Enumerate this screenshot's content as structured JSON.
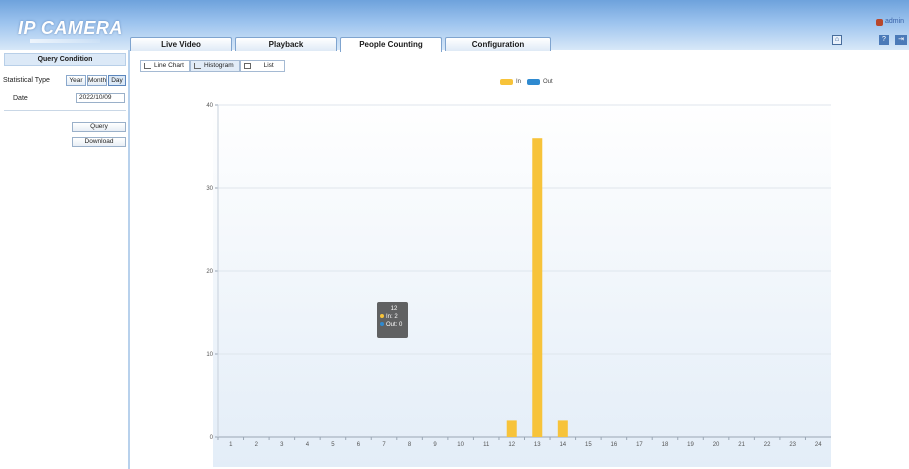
{
  "header": {
    "logo": "IP CAMERA",
    "user": "admin",
    "tabs": [
      {
        "label": "Live Video",
        "active": false
      },
      {
        "label": "Playback",
        "active": false
      },
      {
        "label": "People Counting",
        "active": true
      },
      {
        "label": "Configuration",
        "active": false
      }
    ]
  },
  "sidebar": {
    "title": "Query Condition",
    "stat_type_label": "Statistical Type",
    "stat_buttons": [
      "Year",
      "Month",
      "Day"
    ],
    "selected_stat": "Day",
    "date_label": "Date",
    "date_value": "2022/10/09",
    "query_button": "Query",
    "download_button": "Download"
  },
  "view_tabs": [
    {
      "label": "Line Chart",
      "icon": "line-chart-icon"
    },
    {
      "label": "Histogram",
      "icon": "histogram-icon",
      "selected": true
    },
    {
      "label": "List",
      "icon": "table-icon"
    }
  ],
  "tooltip": {
    "title": "12",
    "in": "In: 2",
    "out": "Out: 0"
  },
  "colors": {
    "in": "#f7c33a",
    "out": "#2f8ad0",
    "accent": "#4a7fbe"
  },
  "chart_data": {
    "type": "bar",
    "categories": [
      "1",
      "2",
      "3",
      "4",
      "5",
      "6",
      "7",
      "8",
      "9",
      "10",
      "11",
      "12",
      "13",
      "14",
      "15",
      "16",
      "17",
      "18",
      "19",
      "20",
      "21",
      "22",
      "23",
      "24"
    ],
    "series": [
      {
        "name": "In",
        "values": [
          0,
          0,
          0,
          0,
          0,
          0,
          0,
          0,
          0,
          0,
          0,
          2,
          36,
          2,
          0,
          0,
          0,
          0,
          0,
          0,
          0,
          0,
          0,
          0
        ]
      },
      {
        "name": "Out",
        "values": [
          0,
          0,
          0,
          0,
          0,
          0,
          0,
          0,
          0,
          0,
          0,
          0,
          0,
          0,
          0,
          0,
          0,
          0,
          0,
          0,
          0,
          0,
          0,
          0
        ]
      }
    ],
    "ylim": [
      0,
      40
    ],
    "yticks": [
      0,
      10,
      20,
      30,
      40
    ],
    "grid": true,
    "legend": "top-center"
  }
}
